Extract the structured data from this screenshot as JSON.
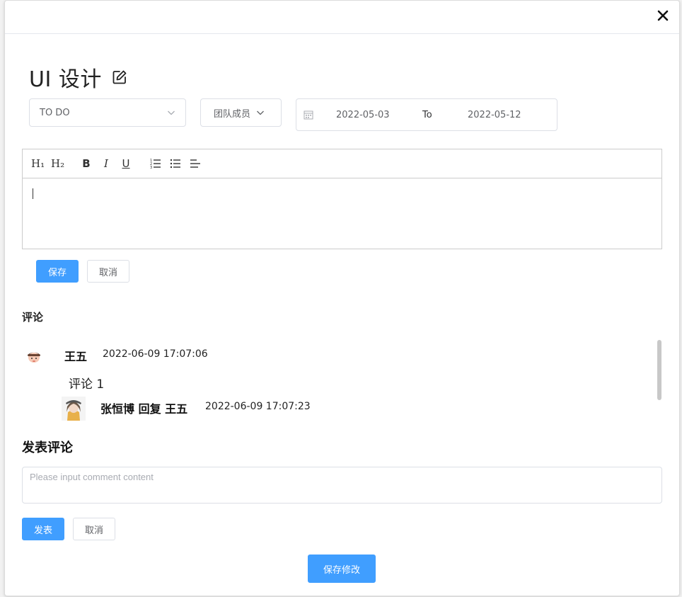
{
  "dialog": {
    "title": "UI 设计",
    "status": "TO DO",
    "members_label": "团队成员",
    "date_start": "2022-05-03",
    "date_separator": "To",
    "date_end": "2022-05-12"
  },
  "editor": {
    "toolbar": {
      "h1": "H₁",
      "h2": "H₂",
      "bold": "B",
      "italic": "I",
      "underline": "U"
    },
    "save_label": "保存",
    "cancel_label": "取消"
  },
  "comments": {
    "section_title": "评论",
    "items": [
      {
        "author": "王五",
        "time": "2022-06-09 17:07:06",
        "content": "评论 1"
      }
    ],
    "replies": [
      {
        "author_line": "张恒博 回复 王五",
        "time": "2022-06-09 17:07:23"
      }
    ]
  },
  "post": {
    "title": "发表评论",
    "placeholder": "Please input comment content",
    "submit_label": "发表",
    "cancel_label": "取消"
  },
  "footer": {
    "save_changes_label": "保存修改"
  },
  "colors": {
    "primary": "#409eff",
    "border": "#dcdfe6"
  }
}
